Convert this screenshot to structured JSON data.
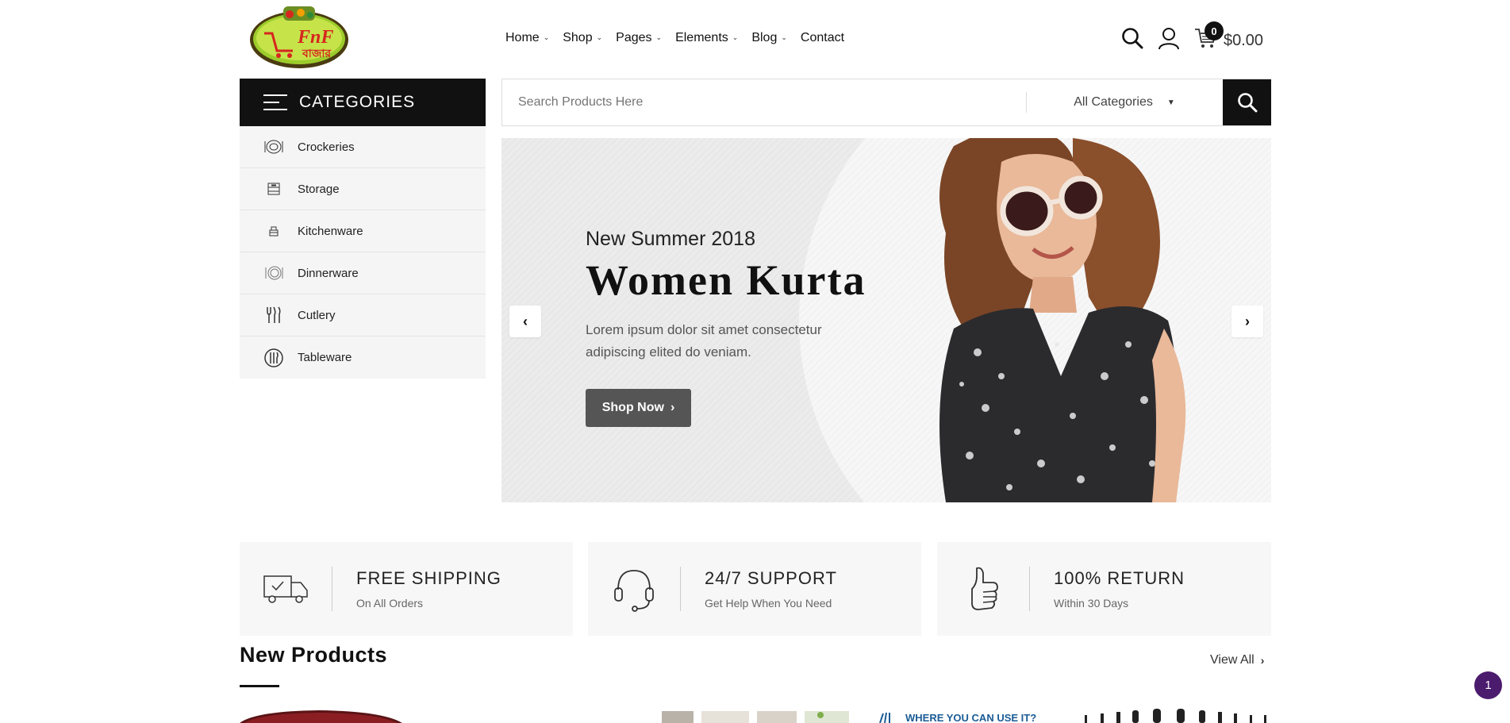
{
  "header": {
    "logo_text": "FnF বাজার",
    "nav": [
      {
        "label": "Home",
        "has_dropdown": true
      },
      {
        "label": "Shop",
        "has_dropdown": true
      },
      {
        "label": "Pages",
        "has_dropdown": true
      },
      {
        "label": "Elements",
        "has_dropdown": true
      },
      {
        "label": "Blog",
        "has_dropdown": true
      },
      {
        "label": "Contact",
        "has_dropdown": false
      }
    ],
    "cart_count": "0",
    "cart_total": "$0.00",
    "icons": [
      "search-icon",
      "user-icon",
      "cart-icon"
    ]
  },
  "categories": {
    "title": "CATEGORIES",
    "items": [
      {
        "label": "Crockeries",
        "icon": "crockery-icon"
      },
      {
        "label": "Storage",
        "icon": "storage-icon"
      },
      {
        "label": "Kitchenware",
        "icon": "kitchenware-icon"
      },
      {
        "label": "Dinnerware",
        "icon": "dinnerware-icon"
      },
      {
        "label": "Cutlery",
        "icon": "cutlery-icon"
      },
      {
        "label": "Tableware",
        "icon": "tableware-icon"
      }
    ]
  },
  "search": {
    "placeholder": "Search Products Here",
    "category_selected": "All Categories"
  },
  "hero": {
    "subtitle": "New Summer 2018",
    "title": "Women Kurta",
    "text": "Lorem ipsum dolor sit amet consectetur adipiscing elited do veniam.",
    "button": "Shop Now"
  },
  "features": [
    {
      "title": "FREE SHIPPING",
      "subtitle": "On All Orders",
      "icon": "delivery-truck-icon"
    },
    {
      "title": "24/7 SUPPORT",
      "subtitle": "Get Help When You Need",
      "icon": "headset-icon"
    },
    {
      "title": "100% RETURN",
      "subtitle": "Within 30 Days",
      "icon": "thumbs-up-icon"
    }
  ],
  "new_products": {
    "title": "New Products",
    "view_all": "View All",
    "peek_banner_text": "WHERE YOU CAN USE IT?"
  },
  "page_bubble": "1",
  "colors": {
    "dark": "#111111",
    "hero_button": "#555555",
    "bubble": "#4b1b6e",
    "logo_green": "#8dc63f",
    "logo_red": "#d7261e"
  }
}
